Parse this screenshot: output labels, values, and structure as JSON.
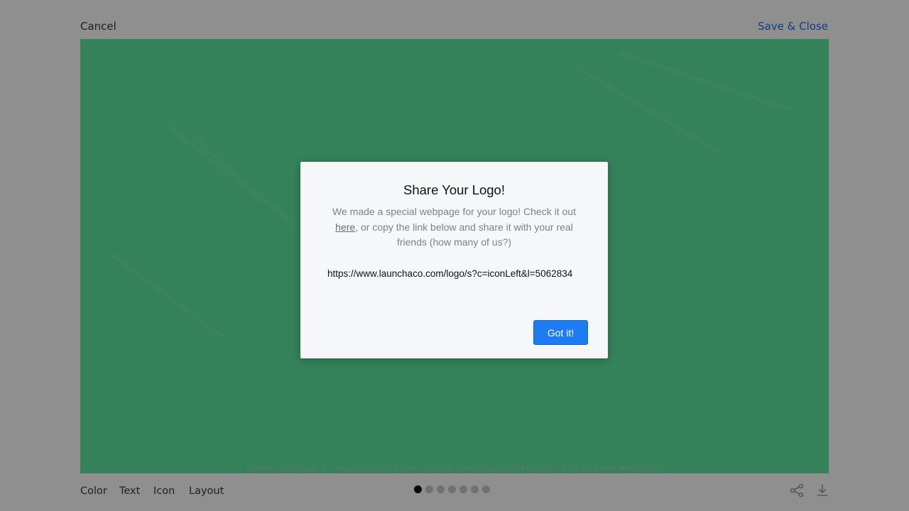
{
  "header": {
    "cancel_label": "Cancel",
    "save_label": "Save & Close"
  },
  "canvas": {
    "background_color": "#5ee6a0",
    "credit_text": "Renner-LightItalic, by indestructible type* licensed under Open Font License. Icon by Julien Meysmans"
  },
  "footer": {
    "tabs": [
      "Color",
      "Text",
      "Icon",
      "Layout"
    ],
    "page_dots": {
      "count": 7,
      "active_index": 0
    },
    "share_icon": "share-icon",
    "download_icon": "download-icon"
  },
  "modal": {
    "title": "Share Your Logo!",
    "desc_before": "We made a special webpage for your logo! Check it out ",
    "desc_link": "here",
    "desc_after": ", or copy the link below and share it with your real friends (how many of us?)",
    "url_value": "https://www.launchaco.com/logo/s?c=iconLeft&l=5062834",
    "confirm_label": "Got it!"
  },
  "colors": {
    "accent": "#1e7cf2",
    "save_link": "#1f6fe0",
    "canvas": "#5ee6a0"
  }
}
